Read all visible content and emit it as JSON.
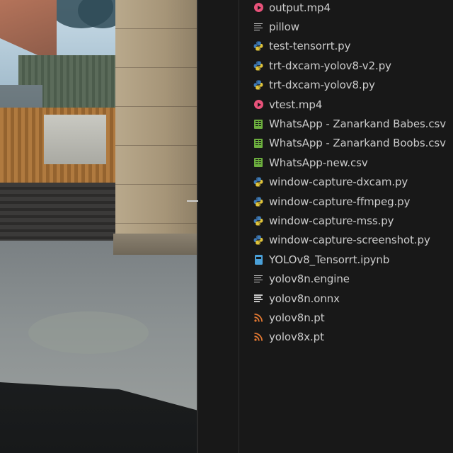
{
  "explorer": {
    "files": [
      {
        "name": "output.mp4",
        "icon": "video-icon"
      },
      {
        "name": "pillow",
        "icon": "text-file-icon"
      },
      {
        "name": "test-tensorrt.py",
        "icon": "python-icon"
      },
      {
        "name": "trt-dxcam-yolov8-v2.py",
        "icon": "python-icon"
      },
      {
        "name": "trt-dxcam-yolov8.py",
        "icon": "python-icon"
      },
      {
        "name": "vtest.mp4",
        "icon": "video-icon"
      },
      {
        "name": "WhatsApp - Zanarkand Babes.csv",
        "icon": "csv-icon"
      },
      {
        "name": "WhatsApp - Zanarkand Boobs.csv",
        "icon": "csv-icon"
      },
      {
        "name": "WhatsApp-new.csv",
        "icon": "csv-icon"
      },
      {
        "name": "window-capture-dxcam.py",
        "icon": "python-icon"
      },
      {
        "name": "window-capture-ffmpeg.py",
        "icon": "python-icon"
      },
      {
        "name": "window-capture-mss.py",
        "icon": "python-icon"
      },
      {
        "name": "window-capture-screenshot.py",
        "icon": "python-icon"
      },
      {
        "name": "YOLOv8_Tensorrt.ipynb",
        "icon": "notebook-icon"
      },
      {
        "name": "yolov8n.engine",
        "icon": "text-file-icon"
      },
      {
        "name": "yolov8n.onnx",
        "icon": "text-file-icon"
      },
      {
        "name": "yolov8n.pt",
        "icon": "rss-icon"
      },
      {
        "name": "yolov8x.pt",
        "icon": "rss-icon"
      }
    ]
  },
  "colors": {
    "background": "#181818",
    "text": "#cccccc",
    "video": "#e8527a",
    "python_blue": "#3d7ab8",
    "python_yellow": "#e0c43a",
    "csv": "#6cae3e",
    "notebook": "#4aa0d8",
    "rss": "#e37933"
  }
}
